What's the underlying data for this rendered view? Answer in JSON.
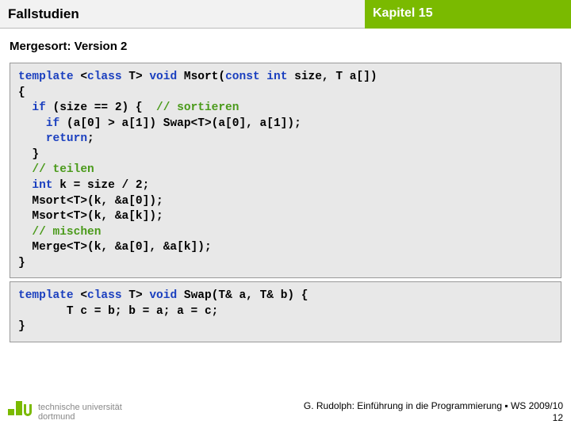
{
  "header": {
    "left": "Fallstudien",
    "right": "Kapitel 15"
  },
  "subtitle": "Mergesort: Version 2",
  "code1": {
    "l1a": "template",
    "l1b": " <",
    "l1c": "class",
    "l1d": " T> ",
    "l1e": "void",
    "l1f": " Msort(",
    "l1g": "const int",
    "l1h": " size, T a[])",
    "l2": "{",
    "l3a": "  ",
    "l3b": "if",
    "l3c": " (size == 2) {  ",
    "l3d": "// sortieren",
    "l4a": "    ",
    "l4b": "if",
    "l4c": " (a[0] > a[1]) Swap<T>(a[0], a[1]);",
    "l5a": "    ",
    "l5b": "return",
    "l5c": ";",
    "l6": "  }",
    "l7a": "  ",
    "l7b": "// teilen",
    "l8a": "  ",
    "l8b": "int",
    "l8c": " k = size / 2;",
    "l9": "  Msort<T>(k, &a[0]);",
    "l10": "  Msort<T>(k, &a[k]);",
    "l11a": "  ",
    "l11b": "// mischen",
    "l12": "  Merge<T>(k, &a[0], &a[k]);",
    "l13": "}"
  },
  "code2": {
    "l1a": "template",
    "l1b": " <",
    "l1c": "class",
    "l1d": " T> ",
    "l1e": "void",
    "l1f": " Swap(T& a, T& b) {",
    "l2": "       T c = b; b = a; a = c;",
    "l3": "}"
  },
  "footer": {
    "uni1": "technische universität",
    "uni2": "dortmund",
    "credit": "G. Rudolph: Einführung in die Programmierung ▪ WS 2009/10",
    "page": "12"
  }
}
